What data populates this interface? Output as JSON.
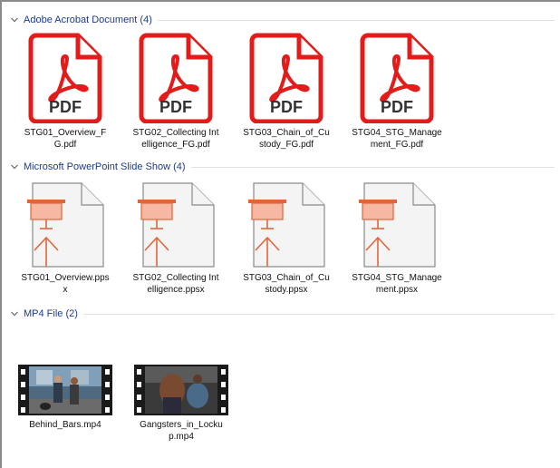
{
  "groups": [
    {
      "title": "Adobe Acrobat Document (4)",
      "items": [
        {
          "name": "STG01_Overview_FG.pdf",
          "badge": "PDF"
        },
        {
          "name": "STG02_Collecting Intelligence_FG.pdf",
          "badge": "PDF"
        },
        {
          "name": "STG03_Chain_of_Custody_FG.pdf",
          "badge": "PDF"
        },
        {
          "name": "STG04_STG_Management_FG.pdf",
          "badge": "PDF"
        }
      ]
    },
    {
      "title": "Microsoft PowerPoint Slide Show (4)",
      "items": [
        {
          "name": "STG01_Overview.ppsx"
        },
        {
          "name": "STG02_Collecting Intelligence.ppsx"
        },
        {
          "name": "STG03_Chain_of_Custody.ppsx"
        },
        {
          "name": "STG04_STG_Management.ppsx"
        }
      ]
    },
    {
      "title": "MP4 File (2)",
      "items": [
        {
          "name": "Behind_Bars.mp4"
        },
        {
          "name": "Gangsters_in_Lockup.mp4"
        }
      ]
    }
  ],
  "colors": {
    "pdf_red": "#e21b1b",
    "ppsx_orange": "#e2653a",
    "header_blue": "#1e3a8a"
  },
  "icons": {
    "collapse": "chevron-down-icon",
    "pdf": "pdf-file-icon",
    "ppsx": "slideshow-file-icon",
    "video": "video-thumbnail"
  }
}
